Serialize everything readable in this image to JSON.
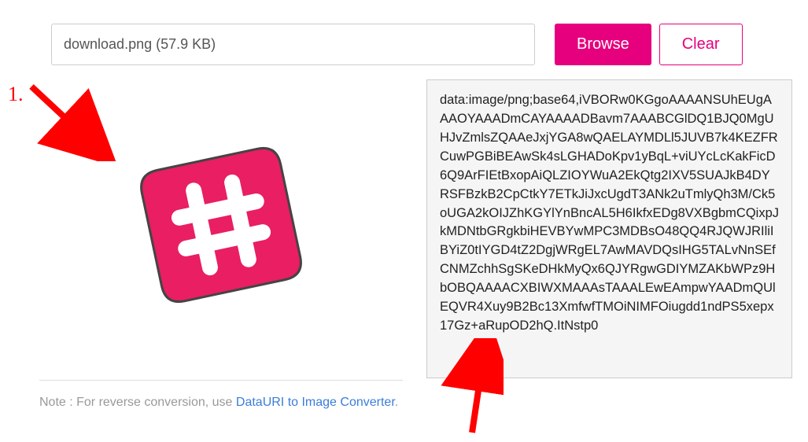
{
  "file_input": {
    "value": "download.png (57.9 KB)"
  },
  "buttons": {
    "browse": "Browse",
    "clear": "Clear"
  },
  "output_text": "data:image/png;base64,iVBORw0KGgoAAAANSUhEUgAAAOYAAADmCAYAAAADBavm7AAABCGlDQ1BJQ0MgUHJvZmlsZQAAeJxjYGA8wQAELAYMDLl5JUVB7k4KEZFRCuwPGBiBEAwSk4sLGHADoKpv1yBqL+viUYcLcKakFicD6Q9ArFIEtBxopAiQLZIOYWuA2EkQtg2IXV5SUAJkB4DYRSFBzkB2CpCtkY7ETkJiJxcUgdT3ANk2uTmlyQh3M/Ck5oUGA2kOIJZhKGYlYnBncAL5H6IkfxEDg8VXBgbmCQixpJkMDNtbGRgkbiHEVBYwMPC3MDBsO48QQ4RJQWJRIliIBYiZ0tIYGD4tZ2DgjWRgEL7AwMAVDQsIHG5TALvNnSEfCNMZchhSgSKeDHkMyQx6QJYRgwGDIYMZAKbWPz9HbOBQAAAACXBIWXMAAAsTAAALEwEAmpwYAADmQUlEQVR4Xuy9B2Bc13XmfwfTMOiNIMFOiugdd1ndPS5xepx17Gz+aRupOD2hQ.ItNstp0",
  "note": {
    "prefix": "Note : For reverse conversion, use ",
    "link": "DataURI to Image Converter",
    "suffix": "."
  },
  "annotation": {
    "label1": "1."
  }
}
